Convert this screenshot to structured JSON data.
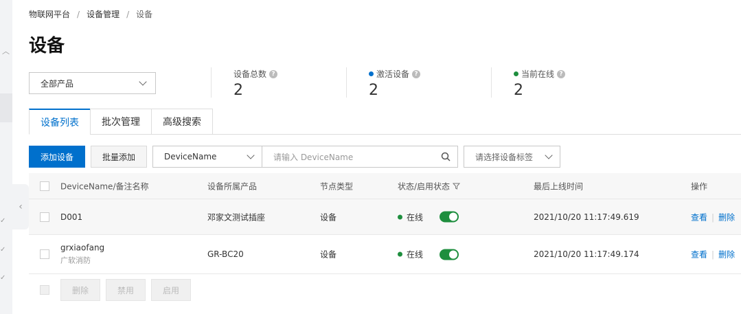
{
  "breadcrumb": [
    "物联网平台",
    "设备管理",
    "设备"
  ],
  "page_title": "设备",
  "product_filter": {
    "value": "全部产品"
  },
  "stats": [
    {
      "label": "设备总数",
      "value": "2",
      "dot_color": ""
    },
    {
      "label": "激活设备",
      "value": "2",
      "dot_color": "#0070cc"
    },
    {
      "label": "当前在线",
      "value": "2",
      "dot_color": "#1e8e3e"
    }
  ],
  "tabs": [
    {
      "label": "设备列表",
      "active": true
    },
    {
      "label": "批次管理",
      "active": false
    },
    {
      "label": "高级搜索",
      "active": false
    }
  ],
  "toolbar": {
    "add_label": "添加设备",
    "batch_add_label": "批量添加",
    "field_select": "DeviceName",
    "search_placeholder": "请输入 DeviceName",
    "tag_placeholder": "请选择设备标签"
  },
  "table": {
    "columns": [
      "DeviceName/备注名称",
      "设备所属产品",
      "节点类型",
      "状态/启用状态",
      "最后上线时间",
      "操作"
    ],
    "rows": [
      {
        "name": "D001",
        "note": "",
        "product": "邓家文测试插座",
        "node_type": "设备",
        "status": "在线",
        "enabled": true,
        "last_online": "2021/10/20 11:17:49.619",
        "actions": [
          "查看",
          "删除"
        ]
      },
      {
        "name": "grxiaofang",
        "note": "广软消防",
        "product": "GR-BC20",
        "node_type": "设备",
        "status": "在线",
        "enabled": true,
        "last_online": "2021/10/20 11:17:49.174",
        "actions": [
          "查看",
          "删除"
        ]
      }
    ]
  },
  "bulk_actions": [
    "删除",
    "禁用",
    "启用"
  ],
  "colors": {
    "primary": "#0070cc",
    "online": "#1e8e3e"
  }
}
